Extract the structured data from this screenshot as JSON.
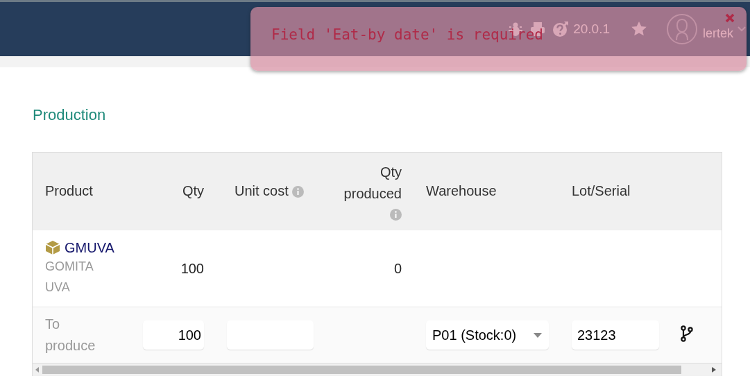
{
  "header": {
    "version": "20.0.1",
    "user": "lertek"
  },
  "toast": {
    "message": "Field 'Eat-by date' is required"
  },
  "section_title": "Production",
  "table": {
    "columns": [
      {
        "label": "Product",
        "info": false
      },
      {
        "label": "Qty",
        "info": false
      },
      {
        "label": "Unit cost",
        "info": true
      },
      {
        "label": "Qty produced",
        "info": true
      },
      {
        "label": "Warehouse",
        "info": false
      },
      {
        "label": "Lot/Serial",
        "info": false
      }
    ],
    "rows": [
      {
        "kind": "line",
        "product_code": "GMUVA",
        "product_name": "GOMITA UVA",
        "qty": "100",
        "qty_produced": "0"
      },
      {
        "kind": "entry",
        "label": "To produce",
        "qty": "100",
        "warehouse": "P01 (Stock:0)",
        "lot": "23123"
      }
    ]
  }
}
